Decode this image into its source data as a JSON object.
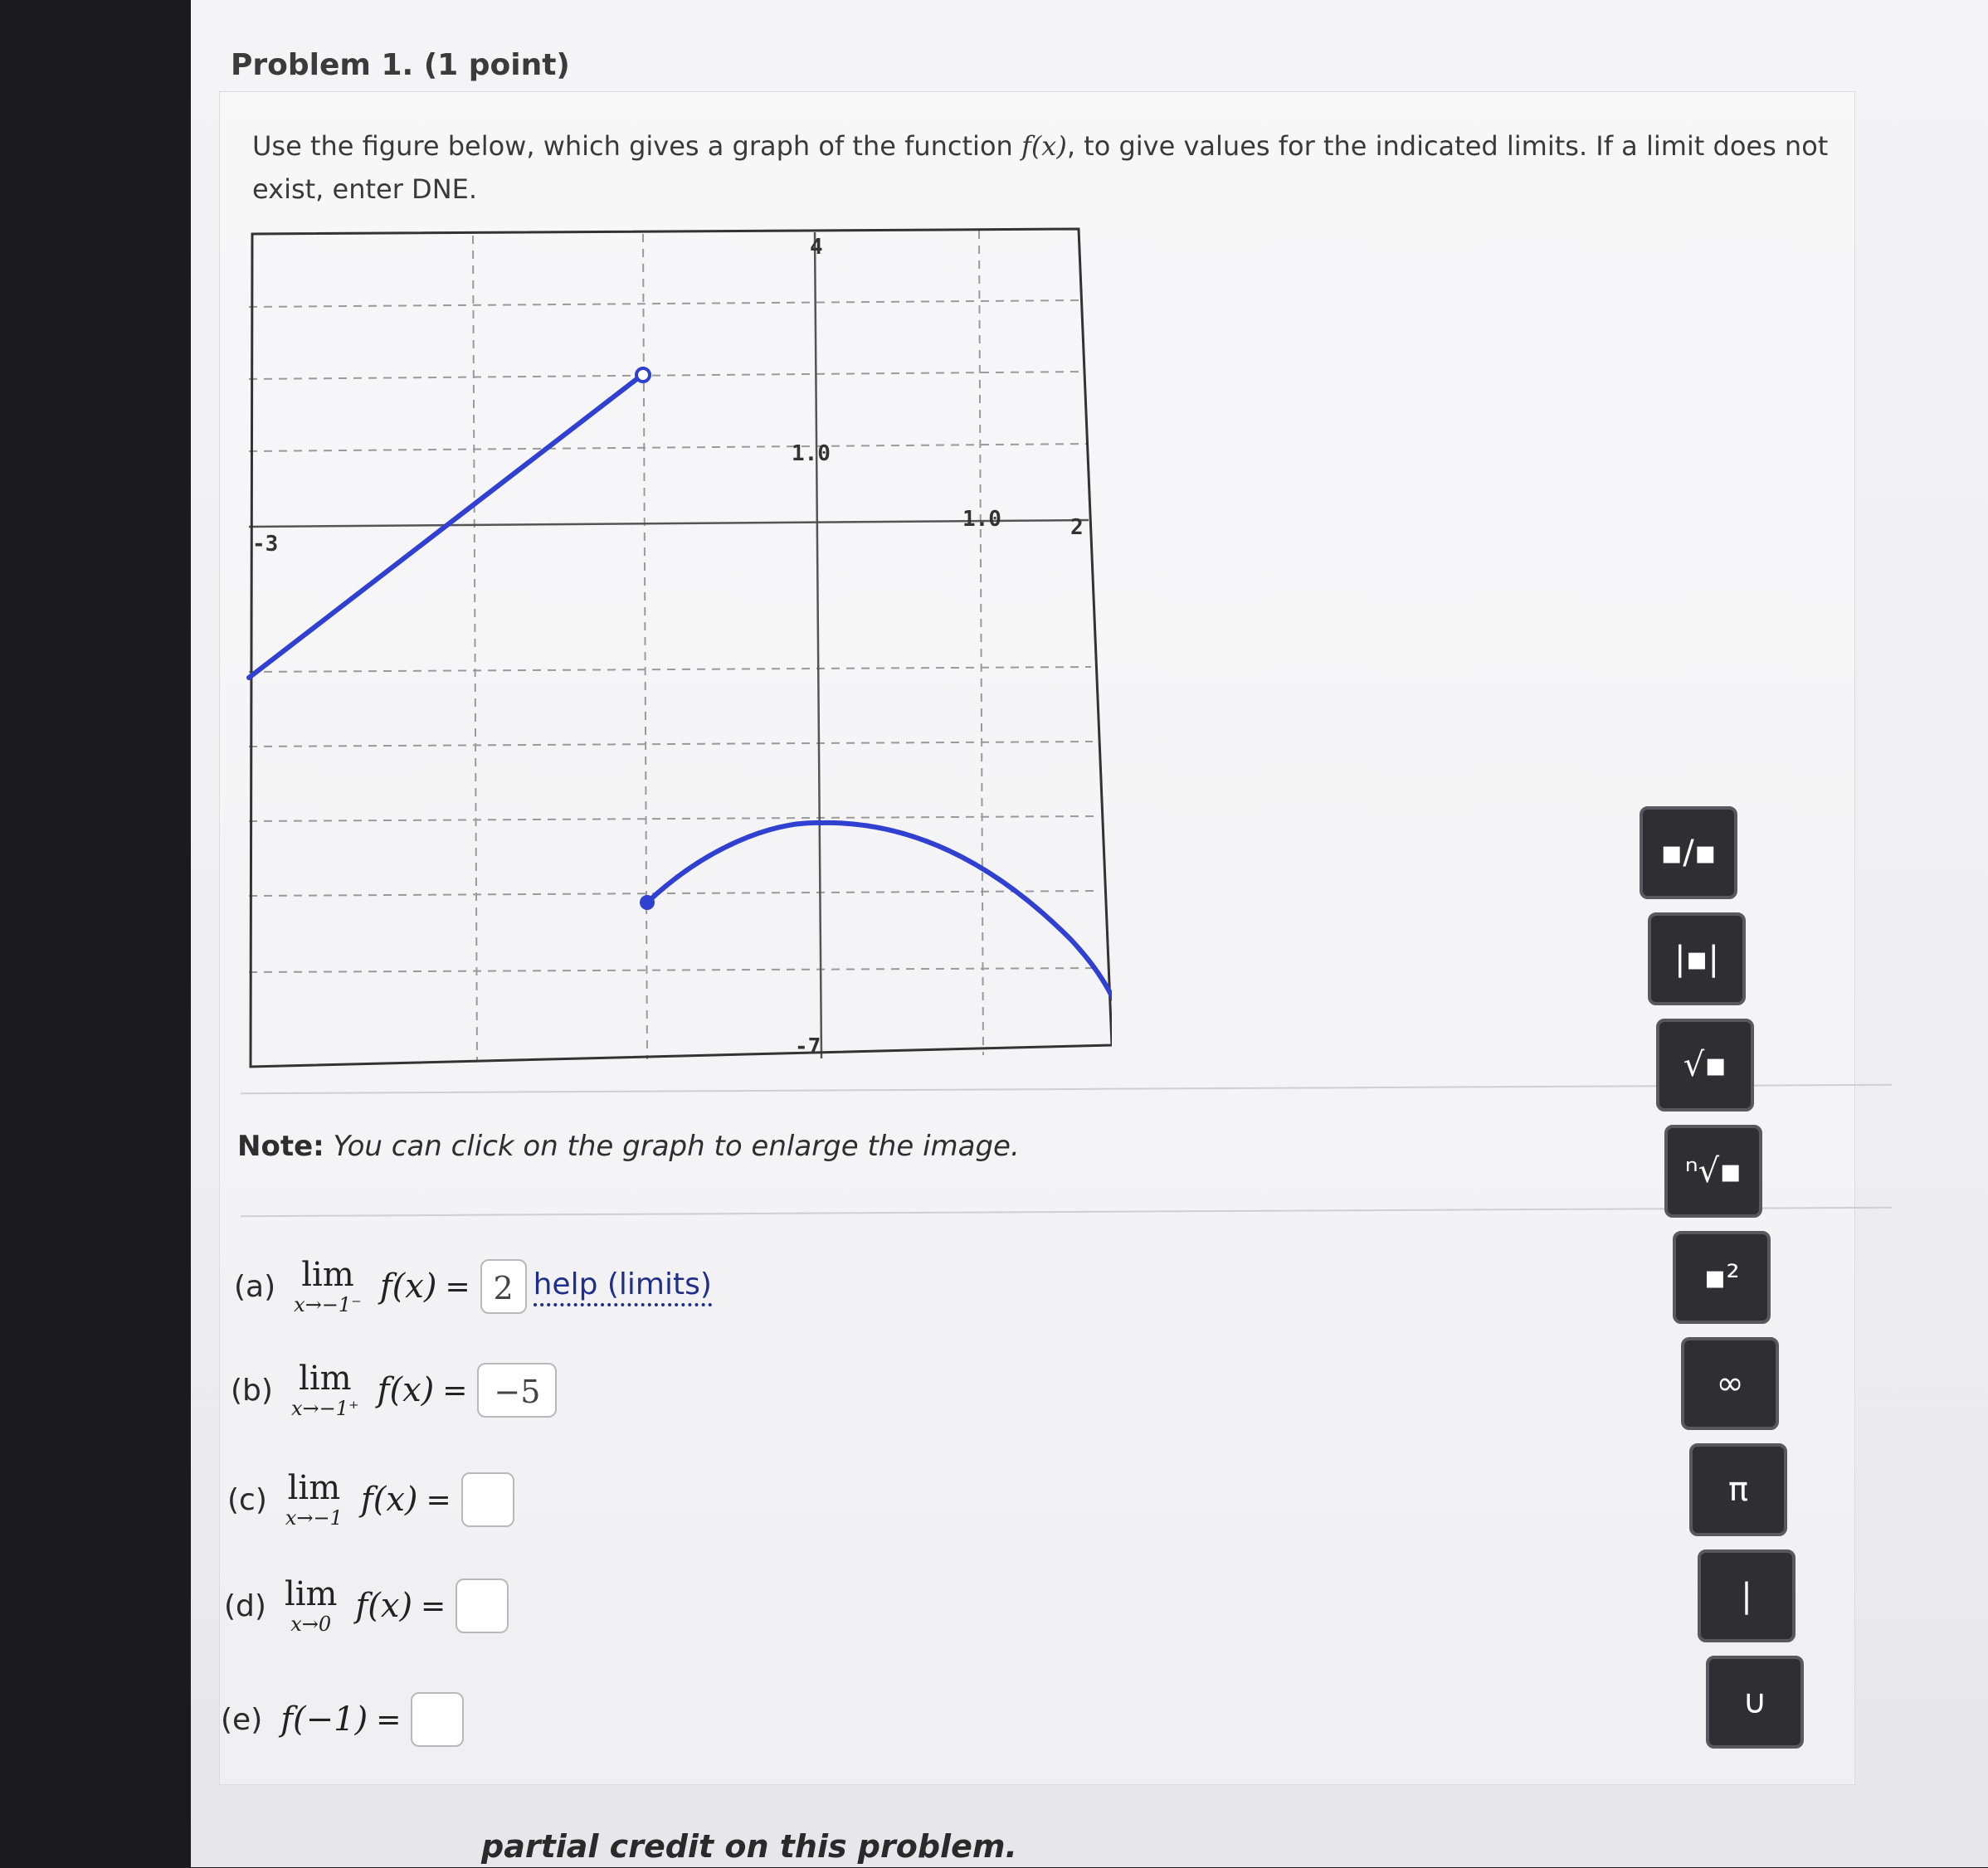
{
  "problem": {
    "title": "Problem 1. (1 point)",
    "prompt_before": "Use the figure below, which gives a graph of the function ",
    "prompt_func": "f(x)",
    "prompt_after": ", to give values for the indicated limits. If a limit does not exist, enter DNE.",
    "note_bold": "Note:",
    "note_text": " You can click on the graph to enlarge the image."
  },
  "graph": {
    "labels": {
      "y_top": "4",
      "y_one": "1.0",
      "x_one": "1.0",
      "x_left": "-3",
      "x_right": "2",
      "y_bottom": "-7"
    },
    "curve_color": "#3040d0"
  },
  "parts": [
    {
      "label": "(a)",
      "lim": "lim",
      "sub": "x→−1⁻",
      "func": "f(x)",
      "eq": "=",
      "value": "2",
      "help": "help (limits)"
    },
    {
      "label": "(b)",
      "lim": "lim",
      "sub": "x→−1⁺",
      "func": "f(x)",
      "eq": "=",
      "value": "−5"
    },
    {
      "label": "(c)",
      "lim": "lim",
      "sub": "x→−1",
      "func": "f(x)",
      "eq": "=",
      "value": ""
    },
    {
      "label": "(d)",
      "lim": "lim",
      "sub": "x→0",
      "func": "f(x)",
      "eq": "=",
      "value": ""
    },
    {
      "label": "(e)",
      "func": "f(−1)",
      "eq": "=",
      "value": ""
    }
  ],
  "footer": "partial credit on this problem.",
  "toolbar": [
    {
      "name": "fraction-icon",
      "glyph": "▪/▪"
    },
    {
      "name": "absolute-value-icon",
      "glyph": "|▪|"
    },
    {
      "name": "sqrt-icon",
      "glyph": "√▪"
    },
    {
      "name": "nth-root-icon",
      "glyph": "ⁿ√▪"
    },
    {
      "name": "exponent-icon",
      "glyph": "▪²"
    },
    {
      "name": "infinity-icon",
      "glyph": "∞"
    },
    {
      "name": "pi-icon",
      "glyph": "π"
    },
    {
      "name": "vertical-bar-icon",
      "glyph": "|"
    },
    {
      "name": "union-icon",
      "glyph": "∪"
    }
  ]
}
